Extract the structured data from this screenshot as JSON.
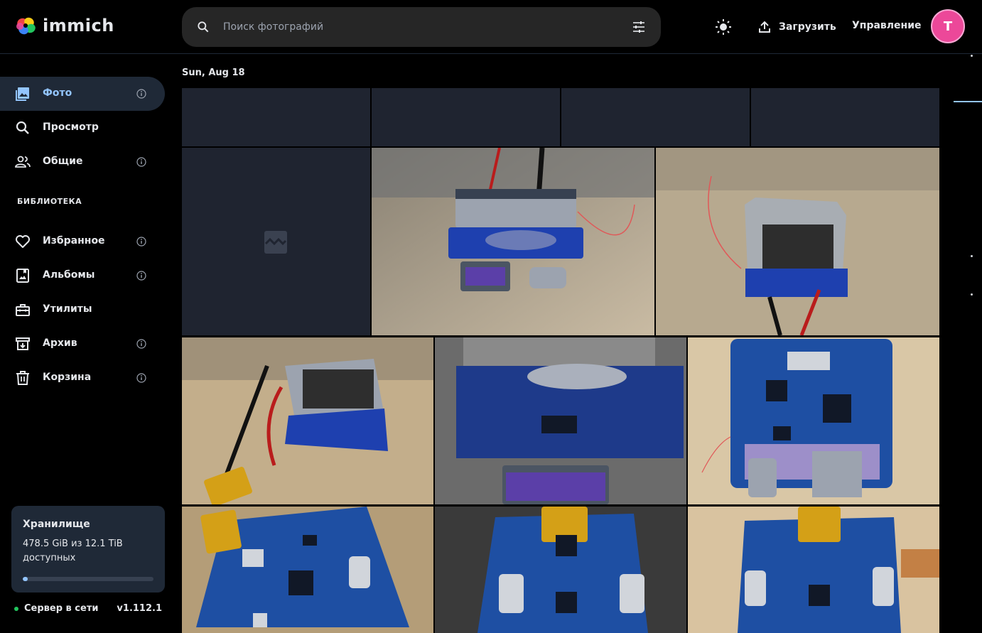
{
  "app": {
    "name": "immich"
  },
  "search": {
    "placeholder": "Поиск фотографий"
  },
  "header": {
    "upload_label": "Загрузить",
    "admin_label": "Управление",
    "avatar_initial": "T",
    "avatar_color": "#ec4899"
  },
  "sidebar": {
    "items": [
      {
        "label": "Фото",
        "icon": "photos-icon",
        "info": true,
        "active": true
      },
      {
        "label": "Просмотр",
        "icon": "search-icon",
        "info": false
      },
      {
        "label": "Общие",
        "icon": "people-icon",
        "info": true
      }
    ],
    "library_title": "БИБЛИОТЕКА",
    "library_items": [
      {
        "label": "Избранное",
        "icon": "heart-icon",
        "info": true
      },
      {
        "label": "Альбомы",
        "icon": "album-icon",
        "info": true
      },
      {
        "label": "Утилиты",
        "icon": "toolbox-icon",
        "info": false
      },
      {
        "label": "Архив",
        "icon": "archive-icon",
        "info": true
      },
      {
        "label": "Корзина",
        "icon": "trash-icon",
        "info": true
      }
    ],
    "storage": {
      "title": "Хранилище",
      "text": "478.5 GiB из 12.1 TiB доступных",
      "used_fraction": 0.04
    },
    "server": {
      "status": "Сервер в сети",
      "version": "v1.112.1"
    }
  },
  "timeline": {
    "date": "Sun, Aug 18"
  },
  "colors": {
    "accent": "#93c5fd",
    "background": "#000000",
    "panel": "#1f2937",
    "pcb_blue": "#1e4fa3"
  }
}
